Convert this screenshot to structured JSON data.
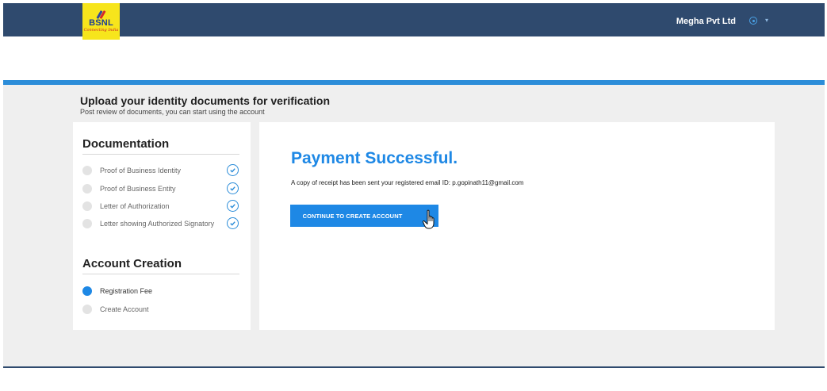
{
  "header": {
    "logo_text": "BSNL",
    "logo_tagline": "Connecting India",
    "company_name": "Megha Pvt Ltd",
    "user_icon": "user-circle-icon",
    "caret_icon": "chevron-down-icon"
  },
  "page": {
    "title": "Upload your identity documents for verification",
    "subtitle": "Post review of documents, you can start using the account"
  },
  "sidebar": {
    "documentation_title": "Documentation",
    "documentation_steps": [
      {
        "label": "Proof of Business Identity",
        "completed": true
      },
      {
        "label": "Proof of Business Entity",
        "completed": true
      },
      {
        "label": "Letter of Authorization",
        "completed": true
      },
      {
        "label": "Letter showing Authorized Signatory",
        "completed": true
      }
    ],
    "account_title": "Account Creation",
    "account_steps": [
      {
        "label": "Registration Fee",
        "active": true
      },
      {
        "label": "Create Account",
        "active": false
      }
    ]
  },
  "main": {
    "heading": "Payment Successful.",
    "receipt_text": "A copy of receipt has been sent your registered email ID: p.gopinath11@gmail.com",
    "continue_label": "CONTINUE TO CREATE ACCOUNT"
  },
  "colors": {
    "header_bg": "#2f4a6e",
    "accent_blue": "#1e88e5",
    "logo_yellow": "#f7e51c",
    "content_bg": "#efefef"
  }
}
